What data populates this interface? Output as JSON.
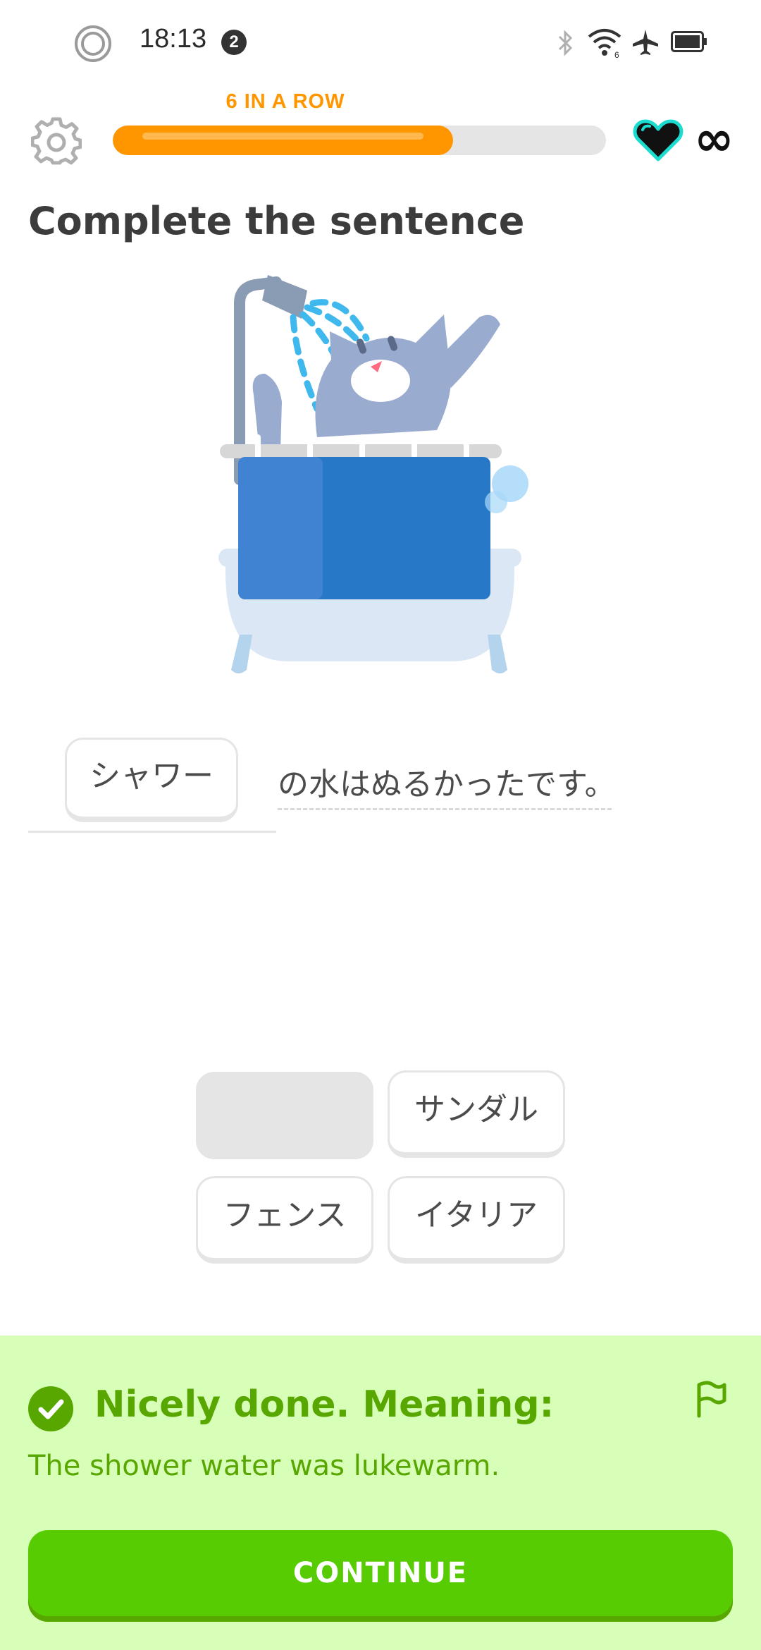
{
  "status_bar": {
    "time": "18:13",
    "notification_count": "2",
    "icons": [
      "record-icon",
      "bluetooth-icon",
      "wifi-icon",
      "airplane-mode-icon",
      "battery-icon"
    ]
  },
  "header": {
    "streak_label": "6 IN A ROW",
    "progress": 0.69,
    "hearts_label": "∞",
    "icons": [
      "settings-gear-icon",
      "heart-icon",
      "infinity-icon"
    ]
  },
  "exercise": {
    "title": "Complete the sentence",
    "selected_answer": "シャワー",
    "sentence_rest": "の水はぬるかったです。"
  },
  "word_bank": {
    "tiles": [
      {
        "label": "",
        "state": "used"
      },
      {
        "label": "サンダル",
        "state": "available"
      },
      {
        "label": "フェンス",
        "state": "available"
      },
      {
        "label": "イタリア",
        "state": "available"
      }
    ]
  },
  "feedback": {
    "title": "Nicely done. Meaning:",
    "translation": "The shower water was lukewarm.",
    "continue_label": "CONTINUE",
    "icons": [
      "check-circle-icon",
      "report-flag-icon"
    ]
  },
  "colors": {
    "streak_orange": "#ff9600",
    "success_green": "#58cc02",
    "success_dark": "#58a700",
    "feedback_bg": "#d7ffb8",
    "heart_border": "#1cdcd0",
    "tub_blue": "#2878c8"
  }
}
